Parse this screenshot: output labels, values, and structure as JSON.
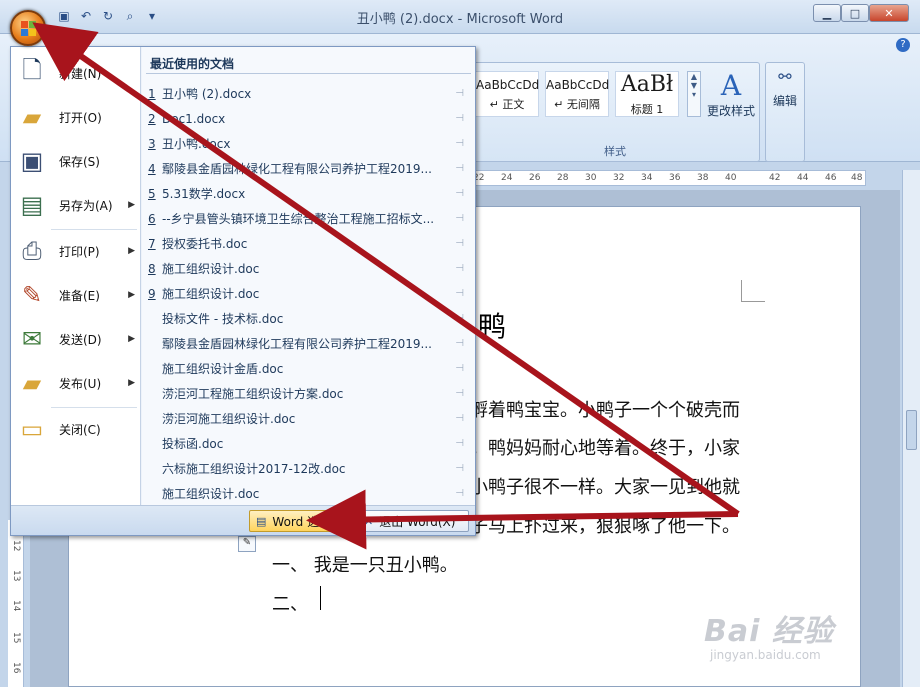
{
  "window": {
    "title": "丑小鸭 (2).docx - Microsoft Word",
    "minimize": "▁",
    "maximize": "□",
    "close": "✕"
  },
  "qat": [
    "save-icon",
    "undo-icon",
    "redo-icon",
    "print-preview-icon",
    "customize-icon"
  ],
  "ribbon": {
    "help": "?",
    "styles": [
      {
        "sample": "AaBbCcDd",
        "name": "↵ 正文"
      },
      {
        "sample": "AaBbCcDd",
        "name": "↵ 无间隔"
      },
      {
        "sample": "AaBł",
        "name": "标题 1"
      }
    ],
    "change_styles_label": "更改样式",
    "styles_group_label": "样式",
    "editing_label": "编辑"
  },
  "ruler": [
    "22",
    "24",
    "26",
    "28",
    "30",
    "32",
    "34",
    "36",
    "38",
    "40",
    "42",
    "44",
    "46",
    "48"
  ],
  "vruler": [
    "12",
    "13",
    "14",
    "15",
    "16"
  ],
  "menu": {
    "items": [
      {
        "label": "新建(N)",
        "icon": "new-document-icon",
        "submenu": false
      },
      {
        "label": "打开(O)",
        "icon": "open-folder-icon",
        "submenu": false
      },
      {
        "label": "保存(S)",
        "icon": "save-icon",
        "submenu": false
      },
      {
        "label": "另存为(A)",
        "icon": "save-as-icon",
        "submenu": true
      },
      {
        "label": "打印(P)",
        "icon": "print-icon",
        "submenu": true
      },
      {
        "label": "准备(E)",
        "icon": "prepare-icon",
        "submenu": true
      },
      {
        "label": "发送(D)",
        "icon": "send-icon",
        "submenu": true
      },
      {
        "label": "发布(U)",
        "icon": "publish-icon",
        "submenu": true
      },
      {
        "label": "关闭(C)",
        "icon": "close-folder-icon",
        "submenu": false
      }
    ],
    "recent_header": "最近使用的文档",
    "recent": [
      {
        "num": "1",
        "name": "丑小鸭 (2).docx"
      },
      {
        "num": "2",
        "name": "Doc1.docx"
      },
      {
        "num": "3",
        "name": "丑小鸭.docx"
      },
      {
        "num": "4",
        "name": "鄢陵县金盾园林绿化工程有限公司养护工程2019..."
      },
      {
        "num": "5",
        "name": "5.31数学.docx"
      },
      {
        "num": "6",
        "name": "--乡宁县管头镇环境卫生综合整治工程施工招标文..."
      },
      {
        "num": "7",
        "name": "授权委托书.doc"
      },
      {
        "num": "8",
        "name": "施工组织设计.doc"
      },
      {
        "num": "9",
        "name": "施工组织设计.doc"
      },
      {
        "num": "",
        "name": "投标文件 - 技术标.doc"
      },
      {
        "num": "",
        "name": "鄢陵县金盾园林绿化工程有限公司养护工程2019..."
      },
      {
        "num": "",
        "name": "施工组织设计金盾.doc"
      },
      {
        "num": "",
        "name": "涝洰河工程施工组织设计方案.doc"
      },
      {
        "num": "",
        "name": "涝洰河施工组织设计.doc"
      },
      {
        "num": "",
        "name": "投标函.doc"
      },
      {
        "num": "",
        "name": "六标施工组织设计2017-12改.doc"
      },
      {
        "num": "",
        "name": "施工组织设计.doc"
      }
    ],
    "word_options": "Word 选项(I)",
    "exit_word": "退出 Word(X)"
  },
  "document": {
    "title": "鸭",
    "lines": [
      "孵着鸭宝宝。小鸭子一个个破壳而",
      "。鸭妈妈耐心地等着。终于，小家",
      "小鸭子很不一样。大家一见到他就",
      "子马上扑过来，狠狠啄了他一下。",
      "一、  我是一只丑小鸭。",
      "二、"
    ]
  },
  "watermark": {
    "logo": "Bai 经验",
    "url": "jingyan.baidu.com"
  },
  "colors": {
    "annotation_arrow": "#a8141c",
    "office_button": "#e67c1a"
  }
}
